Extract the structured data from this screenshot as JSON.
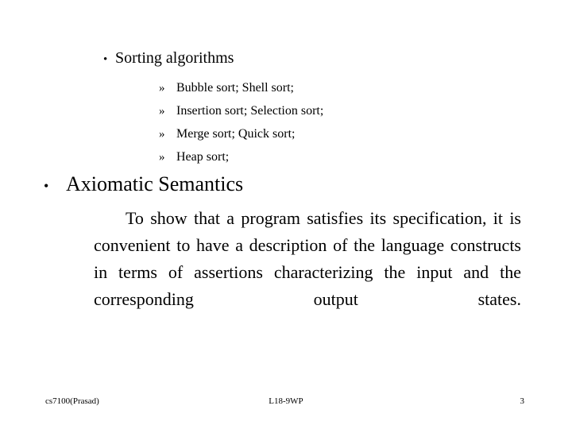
{
  "slide": {
    "background_color": "#ffffff",
    "text_color": "#000000",
    "bullet_marker_level1": "•",
    "bullet_marker_level2": "»",
    "topic_heading": "Sorting algorithms",
    "topic_items": [
      "Bubble sort; Shell sort;",
      "Insertion sort; Selection sort;",
      "Merge sort; Quick sort;",
      "Heap sort;"
    ],
    "section_heading": "Axiomatic Semantics",
    "body_paragraph": "To show that a program satisfies its specification, it is convenient to have a description of the language constructs in terms of assertions characterizing the input and the corresponding output states."
  },
  "footer": {
    "course": "cs7100(Prasad)",
    "lecture": "L18-9WP",
    "page_number": "3"
  }
}
